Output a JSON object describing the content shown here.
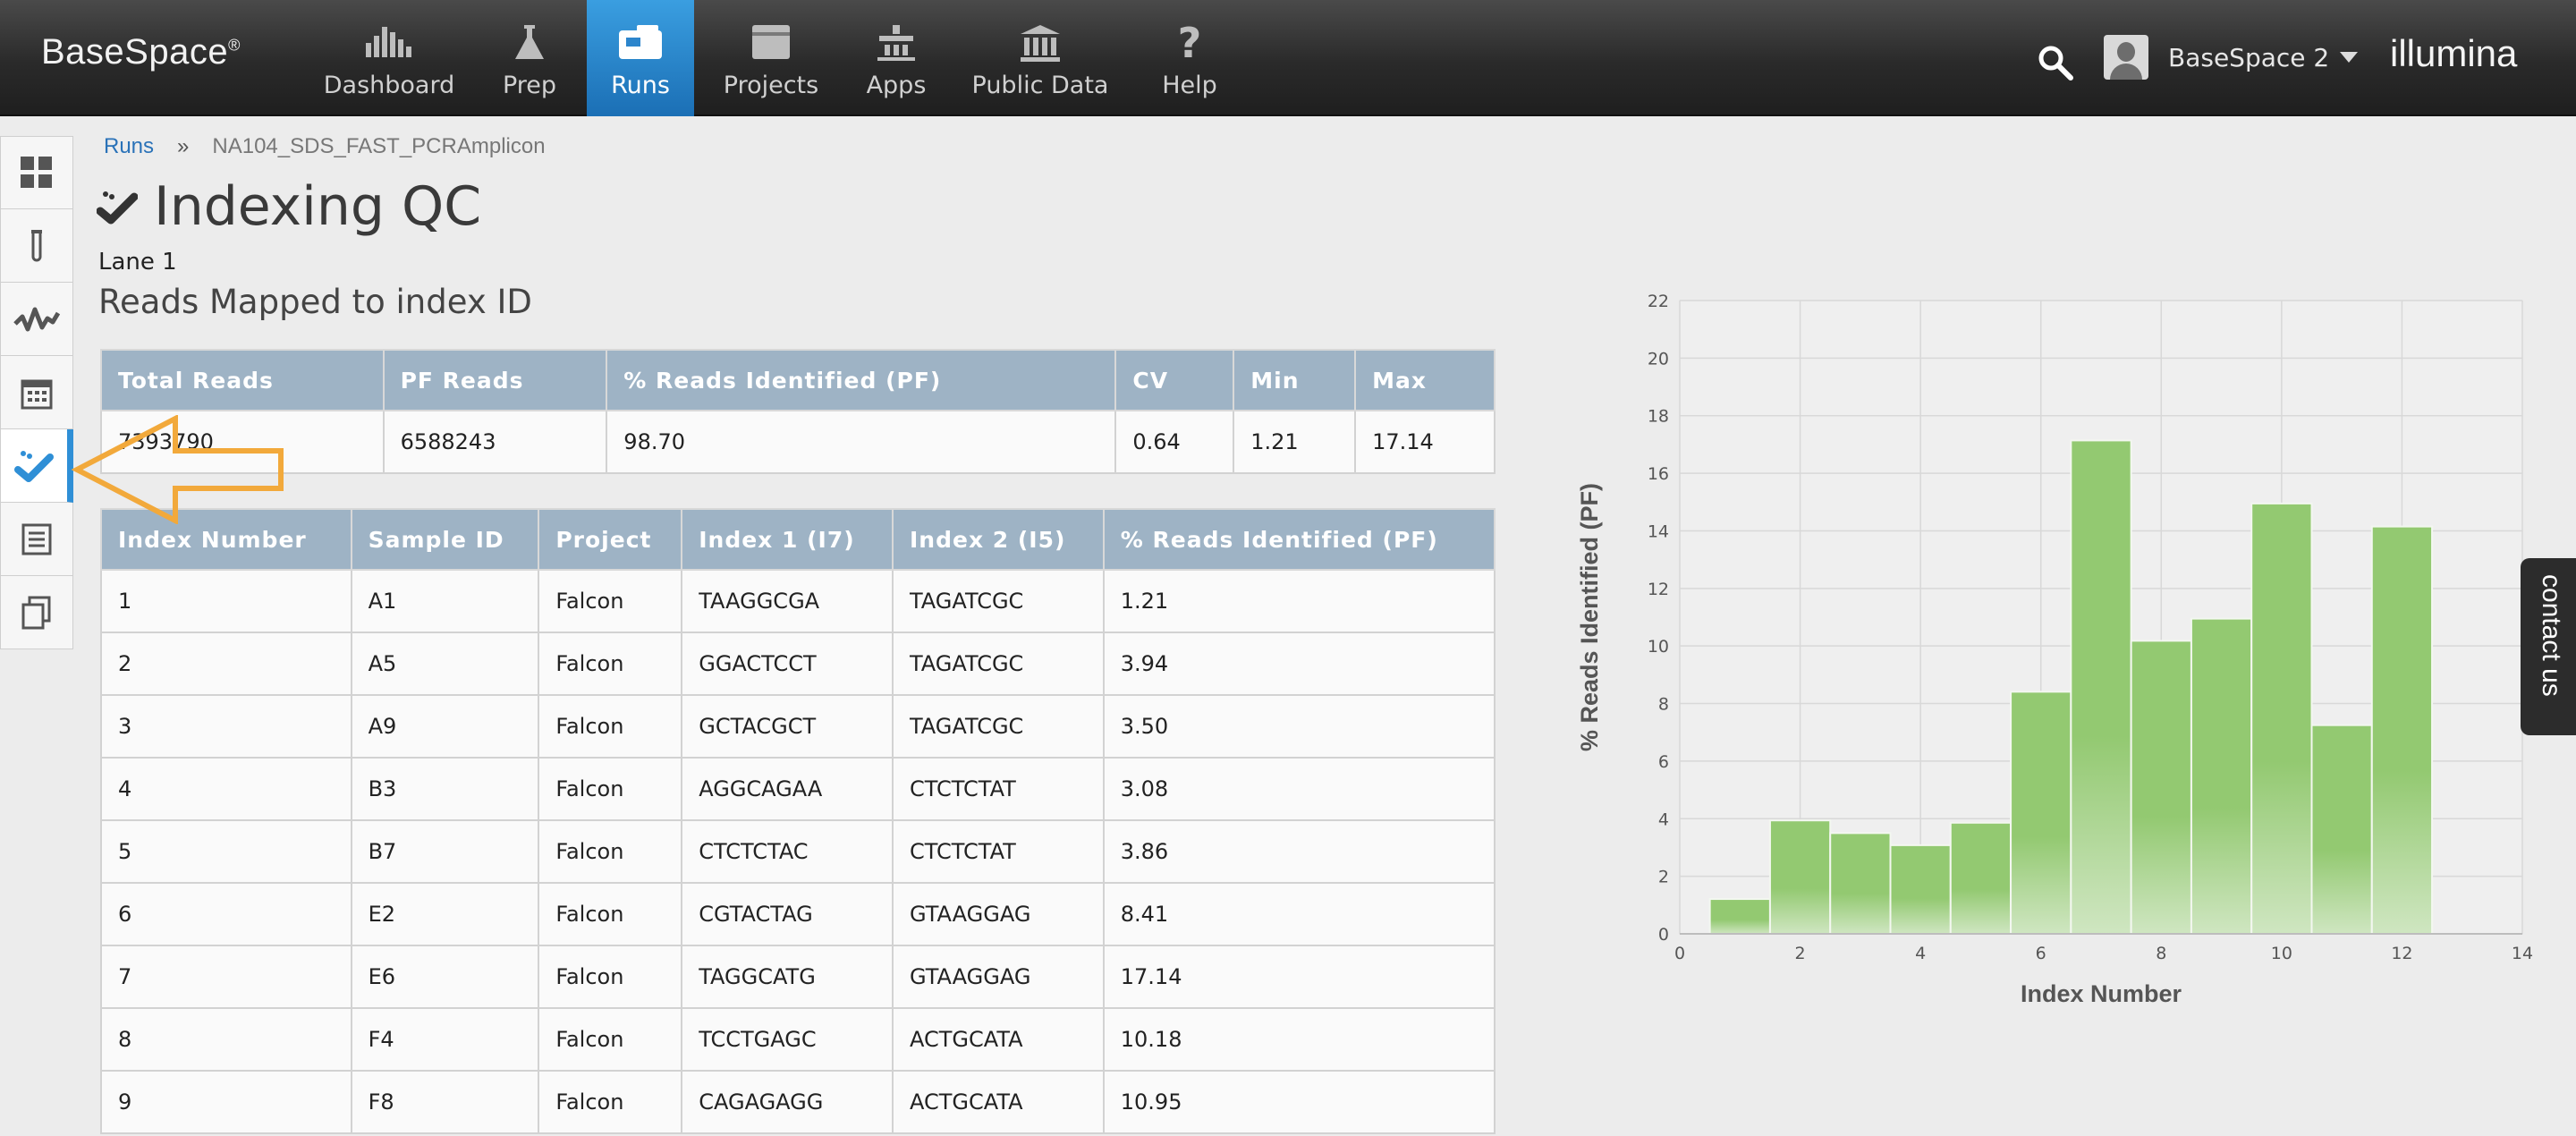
{
  "header": {
    "brand": "BaseSpace",
    "brand_mark": "®",
    "nav": [
      {
        "label": "Dashboard",
        "icon": "dashboard-icon"
      },
      {
        "label": "Prep",
        "icon": "flask-icon"
      },
      {
        "label": "Runs",
        "icon": "runs-icon",
        "active": true
      },
      {
        "label": "Projects",
        "icon": "folder-icon"
      },
      {
        "label": "Apps",
        "icon": "apps-icon"
      },
      {
        "label": "Public Data",
        "icon": "building-icon"
      },
      {
        "label": "Help",
        "icon": "question-icon"
      }
    ],
    "user": "BaseSpace 2",
    "logo": "illumina"
  },
  "sidebar": {
    "items": [
      "grid-icon",
      "test-tube-icon",
      "waveform-icon",
      "calendar-icon",
      "check-icon",
      "list-icon",
      "copy-icon"
    ],
    "active_index": 4
  },
  "breadcrumb": {
    "root": "Runs",
    "separator": "»",
    "current": "NA104_SDS_FAST_PCRAmplicon"
  },
  "page": {
    "title": "Indexing QC",
    "lane": "Lane 1",
    "section_title": "Reads Mapped to index ID"
  },
  "summary": {
    "headers": [
      "Total Reads",
      "PF Reads",
      "% Reads Identified (PF)",
      "CV",
      "Min",
      "Max"
    ],
    "row": [
      "7393790",
      "6588243",
      "98.70",
      "0.64",
      "1.21",
      "17.14"
    ]
  },
  "samples": {
    "headers": [
      "Index Number",
      "Sample ID",
      "Project",
      "Index 1 (I7)",
      "Index 2 (I5)",
      "% Reads Identified (PF)"
    ],
    "rows": [
      [
        "1",
        "A1",
        "Falcon",
        "TAAGGCGA",
        "TAGATCGC",
        "1.21"
      ],
      [
        "2",
        "A5",
        "Falcon",
        "GGACTCCT",
        "TAGATCGC",
        "3.94"
      ],
      [
        "3",
        "A9",
        "Falcon",
        "GCTACGCT",
        "TAGATCGC",
        "3.50"
      ],
      [
        "4",
        "B3",
        "Falcon",
        "AGGCAGAA",
        "CTCTCTAT",
        "3.08"
      ],
      [
        "5",
        "B7",
        "Falcon",
        "CTCTCTAC",
        "CTCTCTAT",
        "3.86"
      ],
      [
        "6",
        "E2",
        "Falcon",
        "CGTACTAG",
        "GTAAGGAG",
        "8.41"
      ],
      [
        "7",
        "E6",
        "Falcon",
        "TAGGCATG",
        "GTAAGGAG",
        "17.14"
      ],
      [
        "8",
        "F4",
        "Falcon",
        "TCCTGAGC",
        "ACTGCATA",
        "10.18"
      ],
      [
        "9",
        "F8",
        "Falcon",
        "CAGAGAGG",
        "ACTGCATA",
        "10.95"
      ]
    ]
  },
  "chart_data": {
    "type": "bar",
    "x": [
      1,
      2,
      3,
      4,
      5,
      6,
      7,
      8,
      9,
      10,
      11,
      12
    ],
    "values": [
      1.21,
      3.94,
      3.5,
      3.08,
      3.86,
      8.41,
      17.14,
      10.18,
      10.95,
      14.95,
      7.25,
      14.15
    ],
    "xlabel": "Index Number",
    "ylabel": "% Reads Identified (PF)",
    "xlim": [
      0,
      14
    ],
    "ylim": [
      0,
      22
    ],
    "xticks": [
      0,
      2,
      4,
      6,
      8,
      10,
      12,
      14
    ],
    "yticks": [
      0,
      2,
      4,
      6,
      8,
      10,
      12,
      14,
      16,
      18,
      20,
      22
    ],
    "grid": true,
    "bar_color": "#93c971"
  },
  "contact": {
    "label": "contact us"
  }
}
